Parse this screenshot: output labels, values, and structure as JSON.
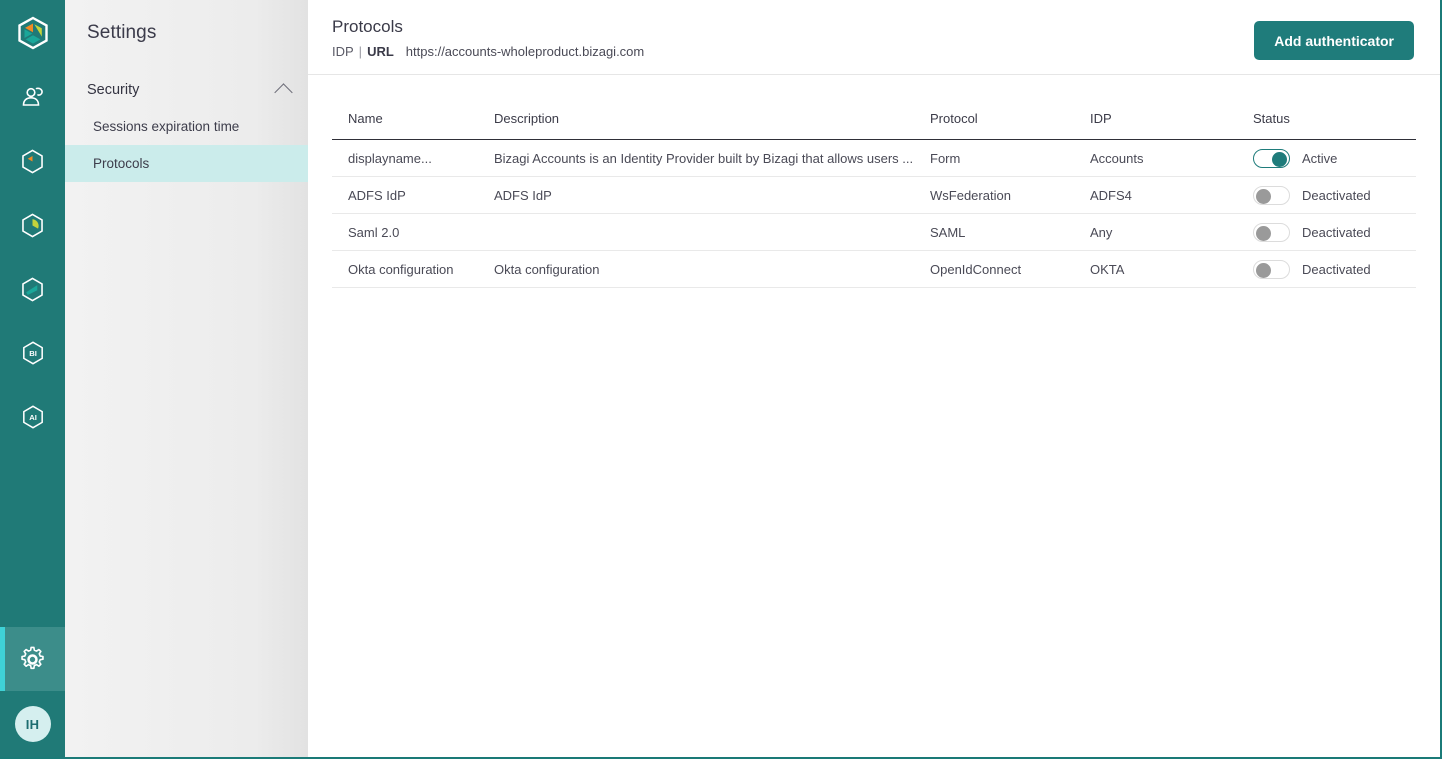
{
  "rail": {
    "logo_name": "bizagi-logo",
    "items": [
      {
        "name": "people-icon",
        "active": false
      },
      {
        "name": "work-portal-icon",
        "active": false
      },
      {
        "name": "analytics-icon",
        "active": false
      },
      {
        "name": "modeler-icon",
        "active": false
      },
      {
        "name": "bi-icon",
        "label": "BI",
        "active": false
      },
      {
        "name": "ai-icon",
        "label": "AI",
        "active": false
      }
    ],
    "gear": {
      "name": "gear-icon",
      "active": true
    },
    "avatar": {
      "initials": "IH"
    }
  },
  "settings": {
    "title": "Settings",
    "group": {
      "label": "Security",
      "expanded": true
    },
    "items": [
      {
        "label": "Sessions expiration time",
        "selected": false
      },
      {
        "label": "Protocols",
        "selected": true
      }
    ]
  },
  "header": {
    "title": "Protocols",
    "sub_idp": "IDP",
    "separator": "|",
    "sub_url_label": "URL",
    "url": "https://accounts-wholeproduct.bizagi.com",
    "add_button": "Add authenticator"
  },
  "table": {
    "columns": [
      "Name",
      "Description",
      "Protocol",
      "IDP",
      "Status"
    ],
    "rows": [
      {
        "name": "displayname...",
        "description": "Bizagi Accounts is an Identity Provider built by Bizagi that allows users ...",
        "protocol": "Form",
        "idp": "Accounts",
        "status": "Active",
        "active": true
      },
      {
        "name": "ADFS IdP",
        "description": "ADFS IdP",
        "protocol": "WsFederation",
        "idp": "ADFS4",
        "status": "Deactivated",
        "active": false
      },
      {
        "name": "Saml 2.0",
        "description": "",
        "protocol": "SAML",
        "idp": "Any",
        "status": "Deactivated",
        "active": false
      },
      {
        "name": "Okta configuration",
        "description": "Okta configuration",
        "protocol": "OpenIdConnect",
        "idp": "OKTA",
        "status": "Deactivated",
        "active": false
      }
    ]
  },
  "colors": {
    "rail_bg": "#207a77",
    "rail_active": "#3c8d8a",
    "rail_indicator": "#3fd2d6",
    "primary": "#1f7c7b",
    "nav_selected": "#cbeceb",
    "avatar_bg": "#d5efef"
  }
}
